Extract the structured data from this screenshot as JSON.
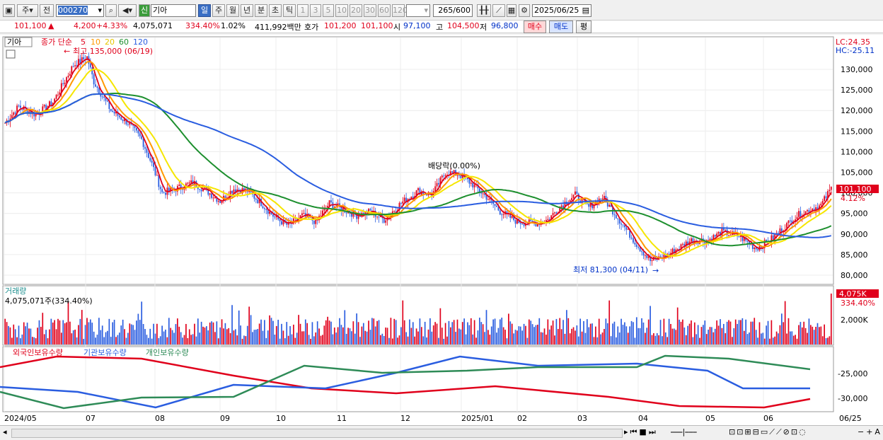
{
  "toolbar": {
    "market_btn": "주",
    "prev_btn": "전",
    "stock_code": "000270",
    "new_badge": "신",
    "stock_name": "기아",
    "periods": [
      "일",
      "주",
      "월",
      "년",
      "분",
      "초",
      "틱"
    ],
    "intervals": [
      "1",
      "3",
      "5",
      "10",
      "20",
      "30",
      "60",
      "120"
    ],
    "count": "265",
    "count_max": "/600",
    "date": "2025/06/25"
  },
  "quote": {
    "price": "101,100",
    "change": "4,200",
    "change_pct": "+4.33%",
    "volume": "4,075,071",
    "volume_ratio": "334.40%",
    "turnover": "1.02%",
    "amount": "411,992백만",
    "bid_label": "호가",
    "bid": "101,200",
    "ask": "101,100",
    "open_label": "시",
    "open": "97,100",
    "high_label": "고",
    "high": "104,500",
    "low_label": "저",
    "low": "96,800",
    "buy_btn": "매수",
    "sell_btn": "매도",
    "eval_btn": "평"
  },
  "price_panel": {
    "name_tag": "기아",
    "ma_label": "종가 단순",
    "ma_periods": [
      "5",
      "10",
      "20",
      "60",
      "120"
    ],
    "ma_colors": [
      "#e0001b",
      "#ff9900",
      "#f5e600",
      "#1d8f2e",
      "#2a5de0"
    ],
    "high_note": "최고 135,000 (06/19)",
    "low_note": "최저 81,300 (04/11)",
    "dividend_note": "배당락(0.00%)",
    "lc": "LC:24.35",
    "hc": "HC:-25.11",
    "last_price": "101,100",
    "last_pct": "4.12%",
    "y_ticks": [
      "130,000",
      "125,000",
      "120,000",
      "115,000",
      "110,000",
      "105,000",
      "100,000",
      "95,000",
      "90,000",
      "85,000",
      "80,000"
    ]
  },
  "volume_panel": {
    "title": "거래량",
    "info": "4,075,071주(334.40%)",
    "last": "4,075K",
    "last_pct": "334.40%",
    "tick": "2,000K"
  },
  "holding_panel": {
    "series": [
      "외국인보유수량",
      "기관보유수량",
      "개인보유수량"
    ],
    "colors": [
      "#e0001b",
      "#2a5de0",
      "#2e8b57"
    ],
    "ticks": [
      "-25,000",
      "-30,000"
    ]
  },
  "x_axis": [
    "2024/05",
    "07",
    "08",
    "09",
    "10",
    "11",
    "12",
    "2025/01",
    "02",
    "03",
    "04",
    "05",
    "06",
    "06/25"
  ]
}
